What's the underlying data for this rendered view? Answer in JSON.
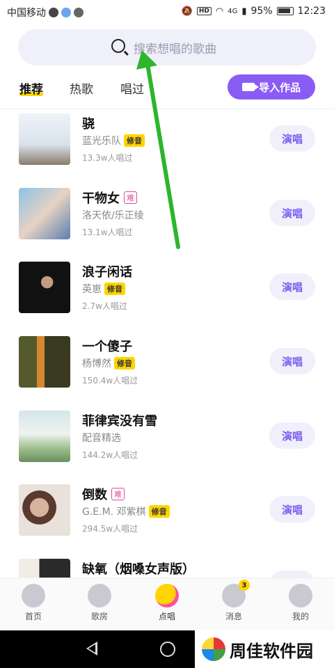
{
  "status_bar": {
    "carrier": "中国移动",
    "network": "4G",
    "battery": "95%",
    "time": "12:23"
  },
  "search": {
    "placeholder": "搜索想唱的歌曲"
  },
  "tabs": [
    {
      "label": "推荐",
      "active": true
    },
    {
      "label": "热歌",
      "active": false
    },
    {
      "label": "唱过",
      "active": false
    }
  ],
  "import_button": {
    "label": "导入作品"
  },
  "songs": [
    {
      "title": "骁",
      "artist": "蓝光乐队",
      "badge": "修音",
      "badge_type": "fix",
      "count": "13.3w人唱过",
      "cover_color": "#eef3f8",
      "action": "演唱"
    },
    {
      "title": "干物女",
      "artist": "洛天依/乐正绫",
      "badge": "难",
      "badge_type": "hard",
      "count": "13.1w人唱过",
      "cover_color": "#9cc5e6",
      "action": "演唱"
    },
    {
      "title": "浪子闲话",
      "artist": "英崽",
      "badge": "修音",
      "badge_type": "fix",
      "count": "2.7w人唱过",
      "cover_color": "#1a1a1a",
      "action": "演唱"
    },
    {
      "title": "一个傻子",
      "artist": "杨博然",
      "badge": "修音",
      "badge_type": "fix",
      "count": "150.4w人唱过",
      "cover_color": "#6b6a3a",
      "action": "演唱"
    },
    {
      "title": "菲律宾没有雪",
      "artist": "配音精选",
      "badge": "",
      "badge_type": "",
      "count": "144.2w人唱过",
      "cover_color": "#b8d3cf",
      "action": "演唱"
    },
    {
      "title": "倒数",
      "artist": "G.E.M. 邓紫棋",
      "badge": "修音",
      "badge_type": "fix",
      "count": "294.5w人唱过",
      "cover_color": "#a0857a",
      "action": "演唱",
      "extra_badge": "难"
    },
    {
      "title": "缺氧（烟嗓女声版）",
      "artist": "",
      "badge": "",
      "badge_type": "",
      "count": "",
      "cover_color": "#e6e6e6",
      "action": "演唱"
    }
  ],
  "tab_bar": [
    {
      "label": "首页",
      "icon": "home-icon",
      "active": false
    },
    {
      "label": "歌房",
      "icon": "room-icon",
      "active": false
    },
    {
      "label": "点唱",
      "icon": "sing-icon",
      "active": true
    },
    {
      "label": "消息",
      "icon": "message-icon",
      "active": false,
      "badge": "3"
    },
    {
      "label": "我的",
      "icon": "profile-icon",
      "active": false
    }
  ],
  "watermark": {
    "text": "周佳软件园"
  },
  "annotation_color": "#2db52d"
}
